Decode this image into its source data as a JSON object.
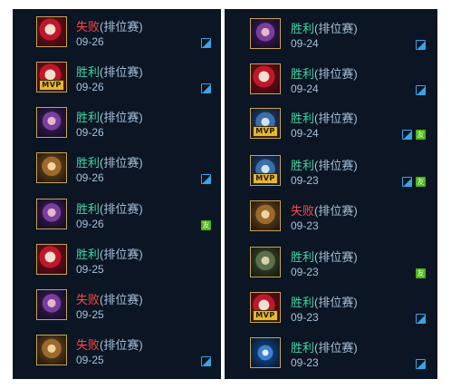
{
  "left": [
    {
      "result": "失败",
      "mode": "(排位赛)",
      "date": "09-26",
      "outcome": "loss",
      "portrait": "red",
      "mvp": false,
      "pic": true,
      "friend": false
    },
    {
      "result": "胜利",
      "mode": "(排位赛)",
      "date": "09-26",
      "outcome": "win",
      "portrait": "red",
      "mvp": true,
      "pic": true,
      "friend": false
    },
    {
      "result": "胜利",
      "mode": "(排位赛)",
      "date": "09-26",
      "outcome": "win",
      "portrait": "purple",
      "mvp": false,
      "pic": false,
      "friend": false
    },
    {
      "result": "胜利",
      "mode": "(排位赛)",
      "date": "09-26",
      "outcome": "win",
      "portrait": "gold",
      "mvp": false,
      "pic": true,
      "friend": false
    },
    {
      "result": "胜利",
      "mode": "(排位赛)",
      "date": "09-26",
      "outcome": "win",
      "portrait": "purple",
      "mvp": false,
      "pic": false,
      "friend": true
    },
    {
      "result": "胜利",
      "mode": "(排位赛)",
      "date": "09-25",
      "outcome": "win",
      "portrait": "red",
      "mvp": false,
      "pic": false,
      "friend": false
    },
    {
      "result": "失败",
      "mode": "(排位赛)",
      "date": "09-25",
      "outcome": "loss",
      "portrait": "purple",
      "mvp": false,
      "pic": false,
      "friend": false
    },
    {
      "result": "失败",
      "mode": "(排位赛)",
      "date": "09-25",
      "outcome": "loss",
      "portrait": "gold",
      "mvp": false,
      "pic": true,
      "friend": false
    }
  ],
  "right": [
    {
      "result": "胜利",
      "mode": "(排位赛)",
      "date": "09-24",
      "outcome": "win",
      "portrait": "purple",
      "mvp": false,
      "pic": true,
      "friend": false
    },
    {
      "result": "胜利",
      "mode": "(排位赛)",
      "date": "09-24",
      "outcome": "win",
      "portrait": "red",
      "mvp": false,
      "pic": true,
      "friend": false
    },
    {
      "result": "胜利",
      "mode": "(排位赛)",
      "date": "09-24",
      "outcome": "win",
      "portrait": "blue",
      "mvp": true,
      "pic": true,
      "friend": true
    },
    {
      "result": "胜利",
      "mode": "(排位赛)",
      "date": "09-23",
      "outcome": "win",
      "portrait": "blue",
      "mvp": true,
      "pic": true,
      "friend": true
    },
    {
      "result": "失败",
      "mode": "(排位赛)",
      "date": "09-23",
      "outcome": "loss",
      "portrait": "gold",
      "mvp": false,
      "pic": false,
      "friend": false
    },
    {
      "result": "胜利",
      "mode": "(排位赛)",
      "date": "09-23",
      "outcome": "win",
      "portrait": "green",
      "mvp": false,
      "pic": false,
      "friend": true
    },
    {
      "result": "胜利",
      "mode": "(排位赛)",
      "date": "09-23",
      "outcome": "win",
      "portrait": "red",
      "mvp": true,
      "pic": true,
      "friend": false
    },
    {
      "result": "胜利",
      "mode": "(排位赛)",
      "date": "09-23",
      "outcome": "win",
      "portrait": "wolf",
      "mvp": false,
      "pic": true,
      "friend": false
    }
  ],
  "labels": {
    "mvp": "MVP",
    "friend": "友"
  },
  "colors": {
    "win": "#3fd6a6",
    "loss": "#ff4747",
    "mode": "#a6c0dc",
    "panel": "#0b1523",
    "pic_icon": "#36a5e8",
    "friend_icon": "#4cb515",
    "mvp_badge": "#e5b631"
  }
}
